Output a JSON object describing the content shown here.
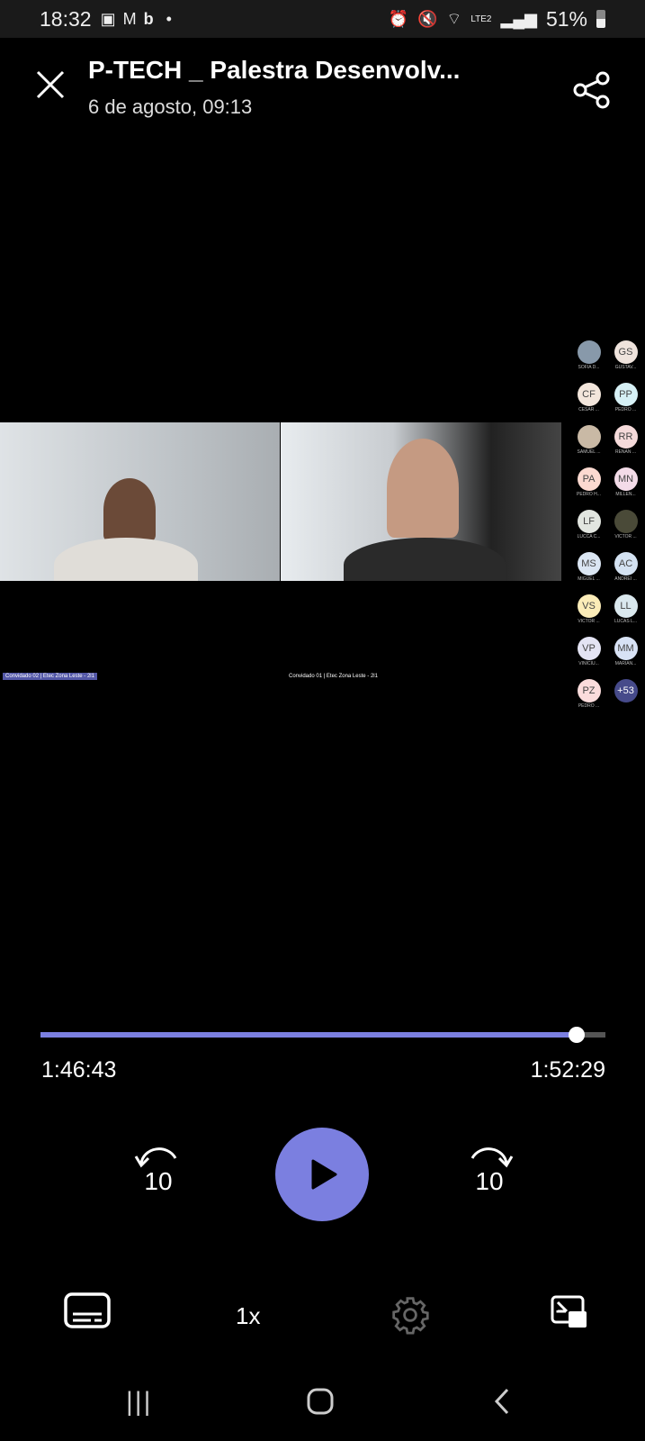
{
  "status_bar": {
    "time": "18:32",
    "battery": "51%",
    "network": "LTE2"
  },
  "header": {
    "title": "P-TECH _ Palestra Desenvolv...",
    "date": "6 de agosto, 09:13"
  },
  "video": {
    "captions": [
      "Convidado 02 | Etec Zona Leste - 2l1",
      "Convidado 01 | Etec Zona Leste - 2l1"
    ],
    "participants": [
      {
        "initials": "",
        "name": "SOFIA D...",
        "color": "#8899aa"
      },
      {
        "initials": "GS",
        "name": "GUSTAV...",
        "color": "#efe3dc"
      },
      {
        "initials": "CF",
        "name": "CESAR ...",
        "color": "#f3e6dc"
      },
      {
        "initials": "PP",
        "name": "PEDRO ...",
        "color": "#d6f0f5"
      },
      {
        "initials": "",
        "name": "SAMUEL ...",
        "color": "#c9b9a5"
      },
      {
        "initials": "RR",
        "name": "RENAN ...",
        "color": "#f5dada"
      },
      {
        "initials": "PA",
        "name": "PEDRO H...",
        "color": "#fbd9d0"
      },
      {
        "initials": "MN",
        "name": "MILLEN...",
        "color": "#f3dbe8"
      },
      {
        "initials": "LF",
        "name": "LUCCA C...",
        "color": "#e2e6e0"
      },
      {
        "initials": "",
        "name": "VICTOR ...",
        "color": "#4a4a38"
      },
      {
        "initials": "MS",
        "name": "MIGUEL ...",
        "color": "#dbe6f3"
      },
      {
        "initials": "AC",
        "name": "ANDREI ...",
        "color": "#d4e2f2"
      },
      {
        "initials": "VS",
        "name": "VICTOR ...",
        "color": "#fbecb8"
      },
      {
        "initials": "LL",
        "name": "LUCAS L...",
        "color": "#dae8ee"
      },
      {
        "initials": "VP",
        "name": "VINICIU...",
        "color": "#e3e3f3"
      },
      {
        "initials": "MM",
        "name": "MARIAN...",
        "color": "#d8e2f5"
      },
      {
        "initials": "PZ",
        "name": "PEDRO ...",
        "color": "#fbdcdc"
      },
      {
        "initials": "+53",
        "name": "",
        "color": "#464a8a"
      }
    ]
  },
  "player": {
    "elapsed": "1:46:43",
    "duration": "1:52:29",
    "progress": 0.9487,
    "skip_back": "10",
    "skip_forward": "10",
    "speed": "1x",
    "accent": "#7b7fe0"
  }
}
